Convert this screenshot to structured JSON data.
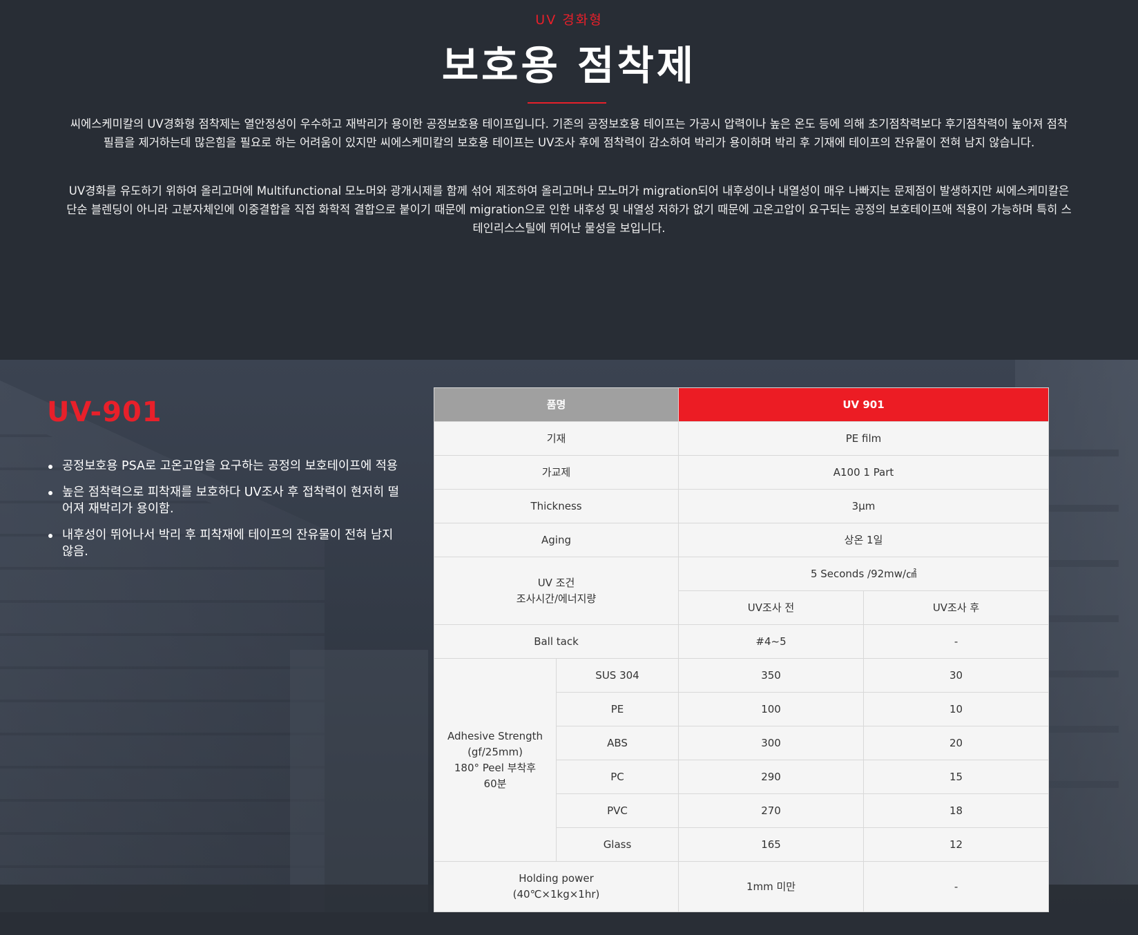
{
  "header": {
    "eyebrow": "UV 경화형",
    "title": "보호용 점착제",
    "paragraphs": [
      "씨에스케미칼의 UV경화형 점착제는 열안정성이 우수하고 재박리가 용이한 공정보호용 테이프입니다. 기존의 공정보호용 테이프는 가공시 압력이나 높은 온도 등에 의해 초기점착력보다 후기점착력이 높아져 점착필름을 제거하는데 많은힘을 필요로 하는 어려움이 있지만 씨에스케미칼의 보호용 테이프는 UV조사 후에 점착력이 감소하여 박리가 용이하며 박리 후 기재에 테이프의 잔유물이 전혀 남지 않습니다.",
      "UV경화를 유도하기 위하여 올리고머에 Multifunctional 모노머와 광개시제를 함께 섞어 제조하여 올리고머나 모노머가 migration되어 내후성이나 내열성이 매우 나빠지는 문제점이 발생하지만 씨에스케미칼은 단순 블렌딩이 아니라 고분자체인에 이중결합을 직접 화학적 결합으로 붙이기 때문에 migration으로 인한 내후성 및 내열성 저하가 없기 때문에 고온고압이 요구되는 공정의 보호테이프애 적용이 가능하며 특히 스테인리스스틸에 뛰어난 물성을 보입니다."
    ]
  },
  "product": {
    "model": "UV-901",
    "features": [
      "공정보호용 PSA로 고온고압을 요구하는 공정의 보호테이프에 적용",
      "높은 점착력으로 피착재를 보호하다 UV조사 후 접착력이 현저히 떨어져 재박리가 용이함.",
      "내후성이 뛰어나서 박리 후 피착재에 테이프의 잔유물이 전혀 남지 않음."
    ]
  },
  "spec": {
    "header_label": "품명",
    "header_product": "UV 901",
    "substrate": {
      "label": "기재",
      "value": "PE film"
    },
    "crosslinker": {
      "label": "가교제",
      "value": "A100 1 Part"
    },
    "thickness": {
      "label": "Thickness",
      "value": "3μm"
    },
    "aging": {
      "label": "Aging",
      "value": "상온 1일"
    },
    "uv_condition": {
      "label_line1": "UV 조건",
      "label_line2": "조사시간/에너지량",
      "value": "5 Seconds /92mw/㎠",
      "before": "UV조사 전",
      "after": "UV조사 후"
    },
    "ball_tack": {
      "label": "Ball tack",
      "before": "#4~5",
      "after": "-"
    },
    "adhesive": {
      "label_line1": "Adhesive Strength",
      "label_line2": "(gf/25mm)",
      "label_line3": "180° Peel 부착후",
      "label_line4": "60분",
      "rows": [
        {
          "material": "SUS 304",
          "before": "350",
          "after": "30"
        },
        {
          "material": "PE",
          "before": "100",
          "after": "10"
        },
        {
          "material": "ABS",
          "before": "300",
          "after": "20"
        },
        {
          "material": "PC",
          "before": "290",
          "after": "15"
        },
        {
          "material": "PVC",
          "before": "270",
          "after": "18"
        },
        {
          "material": "Glass",
          "before": "165",
          "after": "12"
        }
      ]
    },
    "holding": {
      "label_line1": "Holding power",
      "label_line2": "(40℃×1kg×1hr)",
      "before": "1mm 미만",
      "after": "-"
    }
  }
}
